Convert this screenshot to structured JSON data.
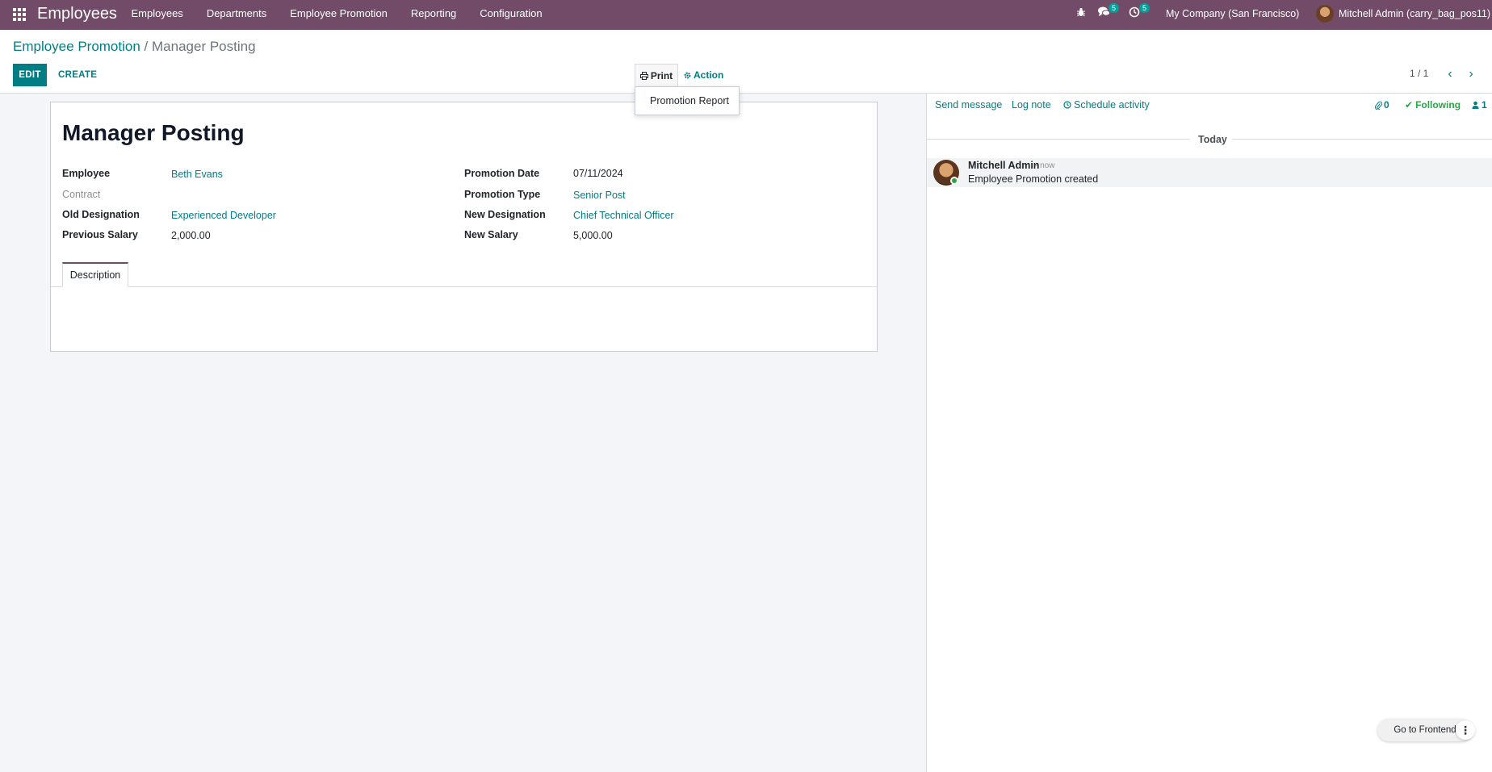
{
  "navbar": {
    "brand": "Employees",
    "menu": [
      "Employees",
      "Departments",
      "Employee Promotion",
      "Reporting",
      "Configuration"
    ],
    "messages_badge": "5",
    "activities_badge": "5",
    "company": "My Company (San Francisco)",
    "user": "Mitchell Admin (carry_bag_pos11)"
  },
  "breadcrumb": {
    "parent": "Employee Promotion",
    "separator": "/",
    "current": "Manager Posting"
  },
  "toolbar": {
    "edit": "EDIT",
    "create": "CREATE",
    "print": "Print",
    "action": "Action",
    "pager": "1 / 1"
  },
  "print_menu": {
    "item": "Promotion Report"
  },
  "form": {
    "title": "Manager Posting",
    "employee_label": "Employee",
    "employee": "Beth Evans",
    "contract_label": "Contract",
    "old_designation_label": "Old Designation",
    "old_designation": "Experienced Developer",
    "previous_salary_label": "Previous Salary",
    "previous_salary": "2,000.00",
    "promotion_date_label": "Promotion Date",
    "promotion_date": "07/11/2024",
    "promotion_type_label": "Promotion Type",
    "promotion_type": "Senior Post",
    "new_designation_label": "New Designation",
    "new_designation": "Chief Technical Officer",
    "new_salary_label": "New Salary",
    "new_salary": "5,000.00",
    "tab": "Description"
  },
  "chatter": {
    "send_message": "Send message",
    "log_note": "Log note",
    "schedule_activity": "Schedule activity",
    "attachments": "0",
    "following": "Following",
    "followers": "1",
    "today": "Today",
    "message": {
      "author": "Mitchell Admin",
      "time": "- now",
      "body": "Employee Promotion created"
    }
  },
  "floating": {
    "go_frontend": "Go to Frontend"
  },
  "colors": {
    "navbar": "#714b67",
    "accent": "#017e84",
    "following": "#28a745"
  }
}
